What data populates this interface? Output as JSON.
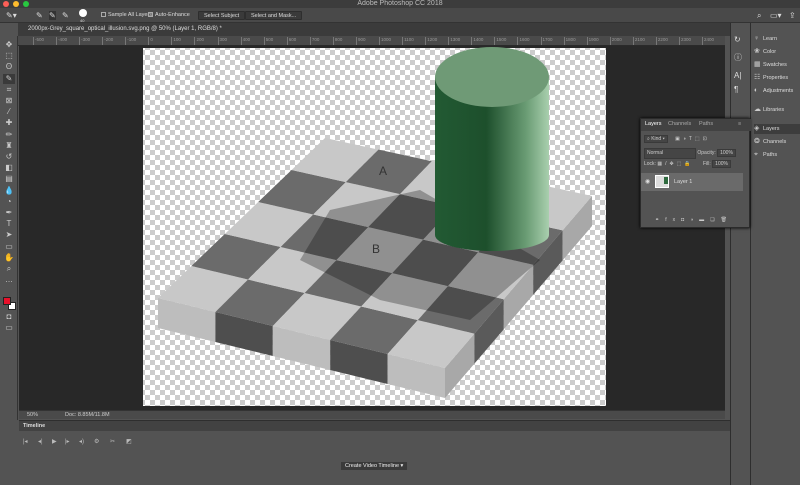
{
  "app": {
    "title": "Adobe Photoshop CC 2018"
  },
  "options": {
    "brush_size": "40",
    "sample_all_layers": "Sample All Layers",
    "auto_enhance": "Auto-Enhance",
    "select_subject": "Select Subject",
    "select_and_mask": "Select and Mask..."
  },
  "document": {
    "tab_title": "2000px-Grey_square_optical_illusion.svg.png @ 50% (Layer 1, RGB/8) *",
    "zoom": "50%",
    "doc_size": "Doc: 8.85M/11.8M",
    "labels": {
      "a": "A",
      "b": "B"
    }
  },
  "ruler": [
    "-500",
    "-400",
    "-300",
    "-200",
    "-100",
    "0",
    "100",
    "200",
    "300",
    "400",
    "500",
    "600",
    "700",
    "800",
    "900",
    "1000",
    "1100",
    "1200",
    "1300",
    "1400",
    "1500",
    "1600",
    "1700",
    "1800",
    "1900",
    "2000",
    "2100",
    "2200",
    "2300",
    "2400"
  ],
  "timeline": {
    "title": "Timeline",
    "create_button": "Create Video Timeline"
  },
  "right_panels": {
    "learn": "Learn",
    "color": "Color",
    "swatches": "Swatches",
    "properties": "Properties",
    "adjustments": "Adjustments",
    "libraries": "Libraries",
    "layers": "Layers",
    "channels": "Channels",
    "paths": "Paths"
  },
  "layers_panel": {
    "tabs": [
      "Layers",
      "Channels",
      "Paths"
    ],
    "filter": "Kind",
    "blend_mode": "Normal",
    "opacity_label": "Opacity:",
    "opacity": "100%",
    "lock_label": "Lock:",
    "fill_label": "Fill:",
    "fill": "100%",
    "layer_name": "Layer 1"
  },
  "colors": {
    "foreground": "#e8102a",
    "background": "#ffffff",
    "cylinder": "#2f6b3f"
  }
}
